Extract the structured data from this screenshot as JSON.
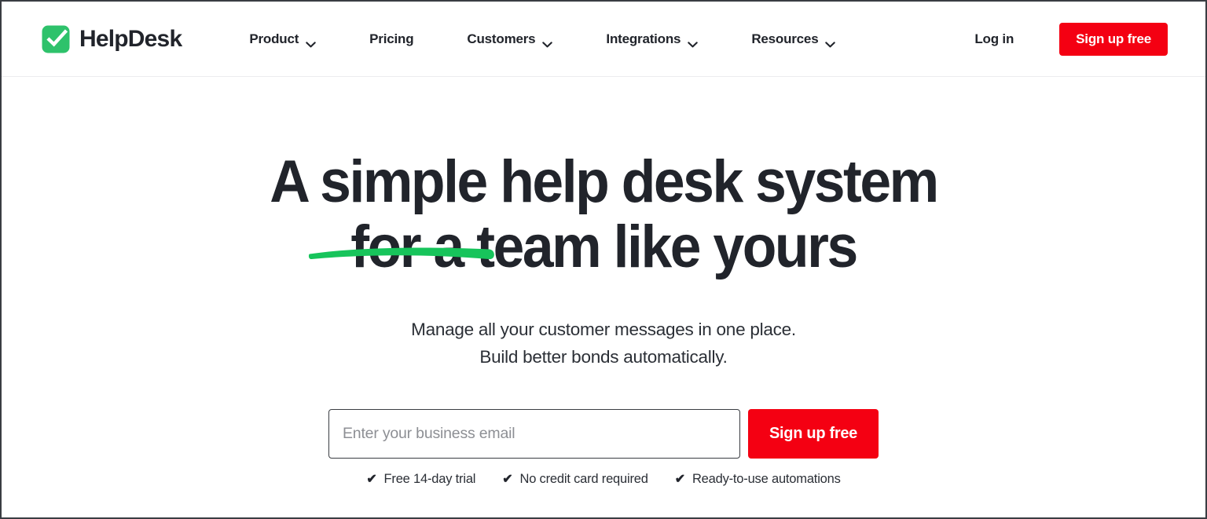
{
  "brand": {
    "name": "HelpDesk",
    "logo_icon": "checkbox-check-icon",
    "logo_color": "#2ec26b"
  },
  "header": {
    "nav": [
      {
        "label": "Product",
        "has_dropdown": true,
        "icon": "chevron-down-icon"
      },
      {
        "label": "Pricing",
        "has_dropdown": false,
        "icon": ""
      },
      {
        "label": "Customers",
        "has_dropdown": true,
        "icon": "chevron-down-icon"
      },
      {
        "label": "Integrations",
        "has_dropdown": true,
        "icon": "chevron-down-icon"
      },
      {
        "label": "Resources",
        "has_dropdown": true,
        "icon": "chevron-down-icon"
      }
    ],
    "login_label": "Log in",
    "signup_label": "Sign up free",
    "signup_color": "#f40012"
  },
  "hero": {
    "headline_line1": "A simple help desk system",
    "headline_line2": "for a team like yours",
    "underline_color": "#17c45b",
    "subtitle_line1": "Manage all your customer messages in one place.",
    "subtitle_line2": "Build better bonds automatically.",
    "email_placeholder": "Enter your business email",
    "email_value": "",
    "cta_label": "Sign up free",
    "features": [
      {
        "check": "✔",
        "label": "Free 14-day trial"
      },
      {
        "check": "✔",
        "label": "No credit card required"
      },
      {
        "check": "✔",
        "label": "Ready-to-use automations"
      }
    ]
  }
}
